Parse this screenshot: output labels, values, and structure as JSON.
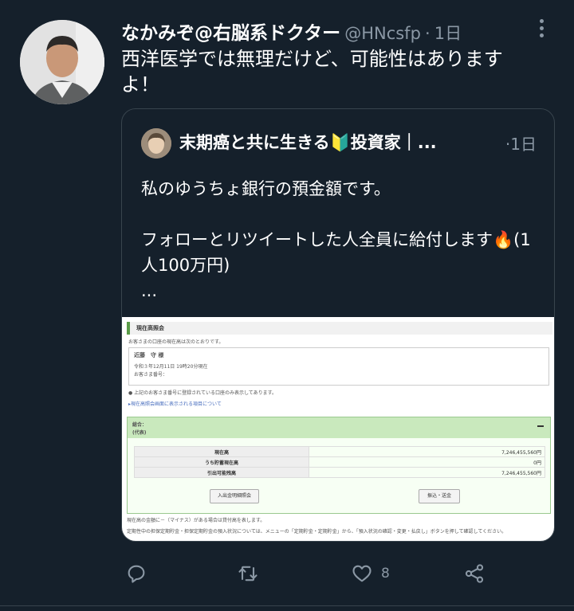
{
  "author": {
    "name": "なかみぞ@右脳系ドクター",
    "handle": "@HNcsfp",
    "dot": "·",
    "time": "1日"
  },
  "tweet_text": "西洋医学では無理だけど、可能性はありますよ！",
  "quoted": {
    "name": "末期癌と共に生きる🔰投資家｜...",
    "time": "·1日",
    "text": "私のゆうちょ銀行の預金額です。\n\nフォローとリツイートした人全員に給付します🔥(1人100万円)\n...",
    "image": {
      "section_title": "現在高照会",
      "intro": "お客さまの口座の現在高は次のとおりです。",
      "customer_name": "近藤　守 様",
      "timestamp": "令和３年12月11日 19時20分現在",
      "account_label": "お客さま番号：",
      "note": "● 上記のお客さま番号に登録されている口座のみ表示してあります。",
      "link": "▸現在高照会画面に表示される項目について",
      "general_label": "総合：",
      "general_sub": "(代表)",
      "rows": [
        {
          "label": "現在高",
          "value": "7,246,455,560円"
        },
        {
          "label": "うち貯蓄現在高",
          "value": "0円"
        },
        {
          "label": "引出可能残高",
          "value": "7,246,455,560円"
        }
      ],
      "btn_left": "入出金明細照会",
      "btn_right": "振込・送金",
      "footer1": "現在高の金額に－（マイナス）がある場合は貸付高を表します。",
      "footer2": "定期性中の担保定期貯金・担保定期貯金の預入状況については、メニューの「定期貯金・定期貯金」から、「預入状況の確認・変更・払戻し」ボタンを押して確認してください。"
    }
  },
  "actions": {
    "like_count": "8"
  },
  "icons": [
    "reply-icon",
    "retweet-icon",
    "like-icon",
    "share-icon",
    "more-icon"
  ],
  "colors": {
    "background": "#15202b",
    "secondary_text": "#8b98a5",
    "border": "#38444d"
  }
}
